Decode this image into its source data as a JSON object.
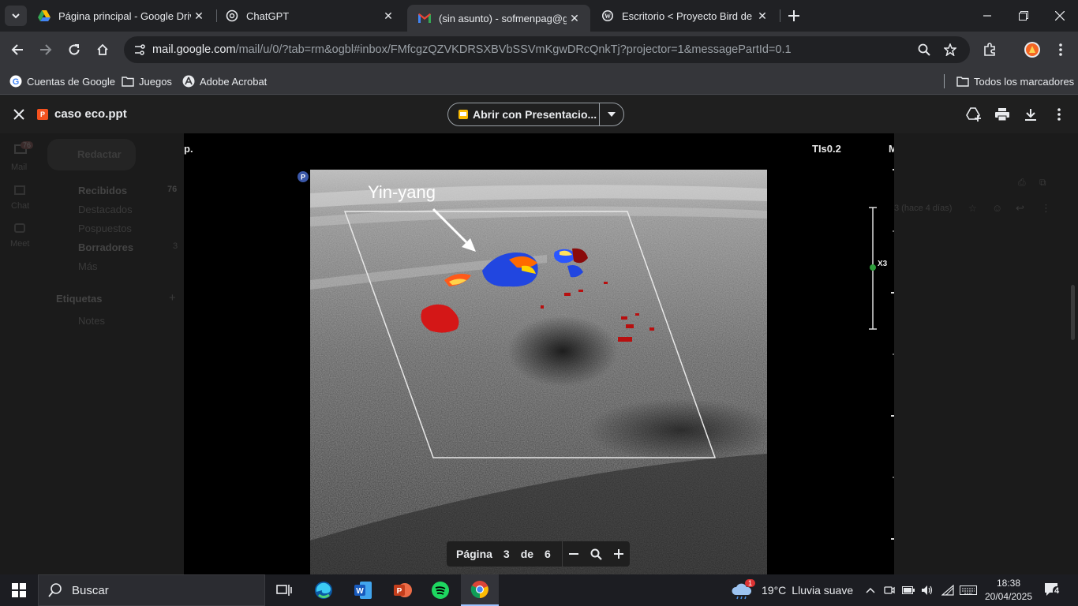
{
  "browser": {
    "tabs": [
      {
        "title": "Página principal - Google Drive",
        "icon": "google-drive-icon"
      },
      {
        "title": "ChatGPT",
        "icon": "chatgpt-icon"
      },
      {
        "title": "(sin asunto) - sofmenpag@gmail.com",
        "icon": "gmail-icon"
      },
      {
        "title": "Escritorio < Proyecto Bird de Microsoft",
        "icon": "wordpress-icon"
      }
    ],
    "url_host": "mail.google.com",
    "url_path": "/mail/u/0/?tab=rm&ogbl#inbox/FMfcgzQZVKDRSXBVbSSVmKgwDRcQnkTj?projector=1&messagePartId=0.1"
  },
  "bookmarks": {
    "items": [
      {
        "label": "Cuentas de Google",
        "icon": "google-icon"
      },
      {
        "label": "Juegos",
        "icon": "folder-icon"
      },
      {
        "label": "Adobe Acrobat",
        "icon": "acrobat-icon"
      }
    ],
    "all_label": "Todos los marcadores"
  },
  "gmail": {
    "mail_badge": "76",
    "rail": [
      "Mail",
      "Chat",
      "Meet"
    ],
    "compose": "Redactar",
    "folders": [
      {
        "label": "Recibidos",
        "count": "76"
      },
      {
        "label": "Destacados",
        "count": ""
      },
      {
        "label": "Pospuestos",
        "count": ""
      },
      {
        "label": "Borradores",
        "count": "3"
      },
      {
        "label": "Más",
        "count": ""
      }
    ],
    "labels_title": "Etiquetas",
    "labels": [
      "Notes"
    ],
    "right_snippet": "3 (hace 4 días)"
  },
  "viewer": {
    "filename": "caso eco.ppt",
    "open_with": "Abrir con Presentacio...",
    "slide": {
      "top_left": "p.",
      "tis": "TIs0.2",
      "top_right": "M",
      "annotation": "Yin-yang",
      "scale_label": "X3"
    },
    "pager": {
      "label": "Página",
      "current": "3",
      "of": "de",
      "total": "6"
    }
  },
  "taskbar": {
    "search_label": "Buscar",
    "weather_temp": "19°C",
    "weather_text": "Lluvia suave",
    "weather_badge": "1",
    "time": "18:38",
    "date": "20/04/2025",
    "notifications": "4"
  },
  "colors": {
    "chrome_bg": "#202124",
    "toolbar_bg": "#35363a",
    "viewer_bar": "#1f1f1f",
    "taskbar_bg": "#1c1d22"
  }
}
